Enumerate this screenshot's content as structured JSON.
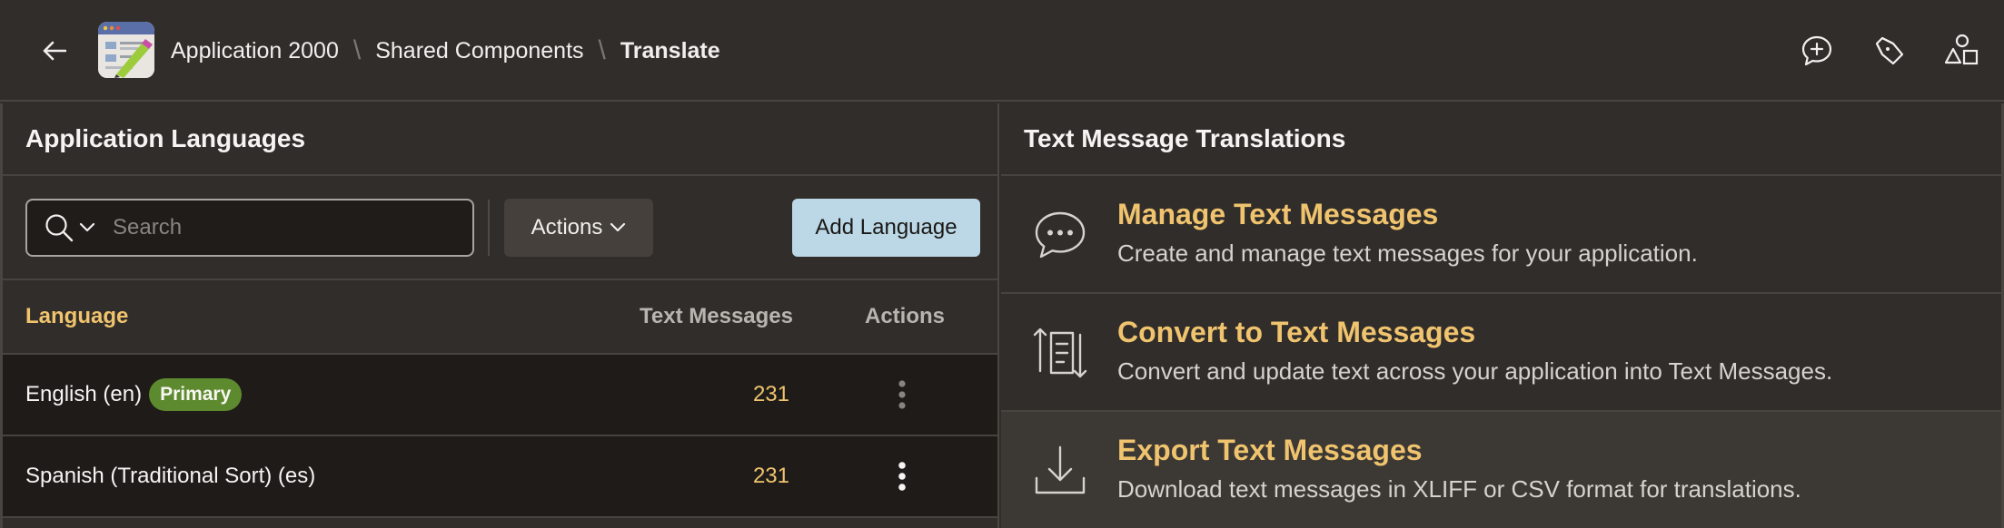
{
  "header": {
    "breadcrumb": [
      "Application 2000",
      "Shared Components",
      "Translate"
    ],
    "separator": "\\"
  },
  "left": {
    "title": "Application Languages",
    "search_placeholder": "Search",
    "actions_label": "Actions",
    "add_label": "Add Language",
    "columns": {
      "language": "Language",
      "messages": "Text Messages",
      "actions": "Actions"
    },
    "rows": [
      {
        "language": "English (en)",
        "badge": "Primary",
        "count": "231"
      },
      {
        "language": "Spanish (Traditional Sort) (es)",
        "badge": "",
        "count": "231"
      }
    ]
  },
  "right": {
    "title": "Text Message Translations",
    "items": [
      {
        "title": "Manage Text Messages",
        "desc": "Create and manage text messages for your application.",
        "icon": "chat-bubble-icon"
      },
      {
        "title": "Convert to Text Messages",
        "desc": "Convert and update text across your application into Text Messages.",
        "icon": "convert-list-icon"
      },
      {
        "title": "Export Text Messages",
        "desc": "Download text messages in XLIFF or CSV format for translations.",
        "icon": "download-icon"
      }
    ]
  },
  "colors": {
    "accent": "#f0c46e",
    "add_button": "#bcd8e6",
    "primary_badge": "#5e8a2f"
  }
}
